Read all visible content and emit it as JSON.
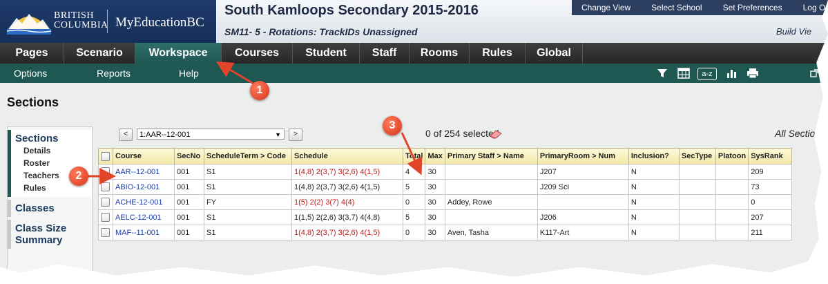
{
  "header": {
    "logo_line1": "BRITISH",
    "logo_line2": "COLUMBIA",
    "app_name": "MyEducationBC",
    "school_title": "South Kamloops Secondary 2015-2016",
    "school_subtitle": "SM11- 5 - Rotations: TrackIDs Unassigned",
    "top_links": [
      "Change View",
      "Select School",
      "Set Preferences",
      "Log O"
    ],
    "build_view": "Build Vie"
  },
  "main_nav": {
    "tabs": [
      {
        "label": "Pages",
        "width": 0
      },
      {
        "label": "Scenario"
      },
      {
        "label": "Workspace",
        "active": true
      },
      {
        "label": "Courses"
      },
      {
        "label": "Student"
      },
      {
        "label": "Staff"
      },
      {
        "label": "Rooms"
      },
      {
        "label": "Rules"
      },
      {
        "label": "Global"
      }
    ]
  },
  "sub_nav": {
    "items": [
      "Options",
      "Reports",
      "Help"
    ],
    "tools": [
      "filter-icon",
      "columns-icon",
      "sort-az-icon",
      "chart-icon",
      "print-icon"
    ],
    "sort_label": "a-z"
  },
  "page": {
    "title": "Sections"
  },
  "side": {
    "sections_label": "Sections",
    "sub_items": [
      "Details",
      "Roster",
      "Teachers",
      "Rules"
    ],
    "classes_label": "Classes",
    "class_size_label": "Class Size",
    "summary_label": "Summary"
  },
  "record_bar": {
    "prev_label": "<",
    "next_label": ">",
    "current": "1:AAR--12-001",
    "selected": "0 of 254 selected",
    "all_sections": "All Sections"
  },
  "table": {
    "columns": [
      "Course",
      "SecNo",
      "ScheduleTerm > Code",
      "Schedule",
      "Total",
      "Max",
      "Primary Staff > Name",
      "PrimaryRoom > Num",
      "Inclusion?",
      "SecType",
      "Platoon",
      "SysRank"
    ],
    "rows": [
      {
        "course": "AAR--12-001",
        "secno": "001",
        "term": "S1",
        "schedule": "1(4,8) 2(3,7) 3(2,6) 4(1,5)",
        "red": true,
        "total": "4",
        "max": "30",
        "staff": "",
        "room": "J207",
        "inclusion": "N",
        "sectype": "",
        "platoon": "",
        "sysrank": "209"
      },
      {
        "course": "ABIO-12-001",
        "secno": "001",
        "term": "S1",
        "schedule": "1(4,8) 2(3,7) 3(2,6) 4(1,5)",
        "red": false,
        "total": "5",
        "max": "30",
        "staff": "",
        "room": "J209 Sci",
        "inclusion": "N",
        "sectype": "",
        "platoon": "",
        "sysrank": "73"
      },
      {
        "course": "ACHE-12-001",
        "secno": "001",
        "term": "FY",
        "schedule": "1(5) 2(2) 3(7) 4(4)",
        "red": true,
        "total": "0",
        "max": "30",
        "staff": "Addey, Rowe",
        "room": "",
        "inclusion": "N",
        "sectype": "",
        "platoon": "",
        "sysrank": "0"
      },
      {
        "course": "AELC-12-001",
        "secno": "001",
        "term": "S1",
        "schedule": "1(1,5) 2(2,6) 3(3,7) 4(4,8)",
        "red": false,
        "total": "5",
        "max": "30",
        "staff": "",
        "room": "J206",
        "inclusion": "N",
        "sectype": "",
        "platoon": "",
        "sysrank": "207"
      },
      {
        "course": "MAF--11-001",
        "secno": "001",
        "term": "S1",
        "schedule": "1(4,8) 2(3,7) 3(2,6) 4(1,5)",
        "red": true,
        "total": "0",
        "max": "30",
        "staff": "Aven, Tasha",
        "room": "K117-Art",
        "inclusion": "N",
        "sectype": "",
        "platoon": "",
        "sysrank": "211"
      }
    ]
  },
  "annotations": [
    "1",
    "2",
    "3"
  ],
  "colors": {
    "accent": "#1f5753",
    "callout": "#e0452a",
    "link": "#1a3aa8",
    "schedule_red": "#c01818"
  }
}
